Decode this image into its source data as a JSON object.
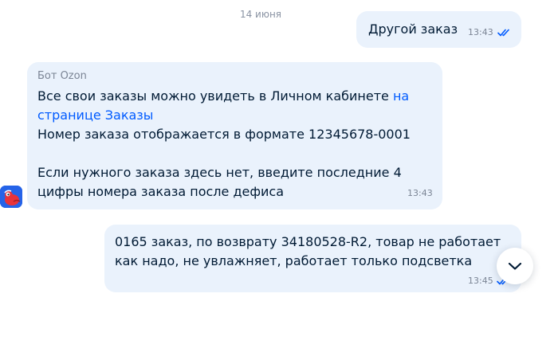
{
  "chat": {
    "date_separator": "14 июня",
    "messages": [
      {
        "direction": "outgoing",
        "lines": [
          "Другой заказ"
        ],
        "time": "13:43",
        "read": true
      },
      {
        "direction": "incoming",
        "sender": "Бот Ozon",
        "line1_text": "Все свои заказы можно увидеть в Личном кабинете ",
        "line1_link": "на",
        "line2_link": "странице Заказы",
        "line3": "Номер заказа отображается в формате 12345678-0001",
        "line4": "Если нужного заказа здесь нет, введите последние 4",
        "line5": "цифры номера заказа после дефиса",
        "time": "13:43"
      },
      {
        "direction": "outgoing",
        "lines": [
          "0165 заказ, по возврату 34180528-R2, товар не работает",
          "как надо, не увлажняет, работает только подсветка"
        ],
        "time": "13:45",
        "read": true
      }
    ]
  },
  "icons": {
    "read_ticks": "double-check-icon",
    "bot_avatar": "ozon-bot-avatar",
    "scroll_down": "chevron-down-icon"
  },
  "colors": {
    "bubble_background": "#eaf2fc",
    "text": "#001a34",
    "link": "#005bff",
    "meta_text": "#7b8595",
    "read_ticks": "#005bff",
    "avatar_background": "#2563e8"
  }
}
